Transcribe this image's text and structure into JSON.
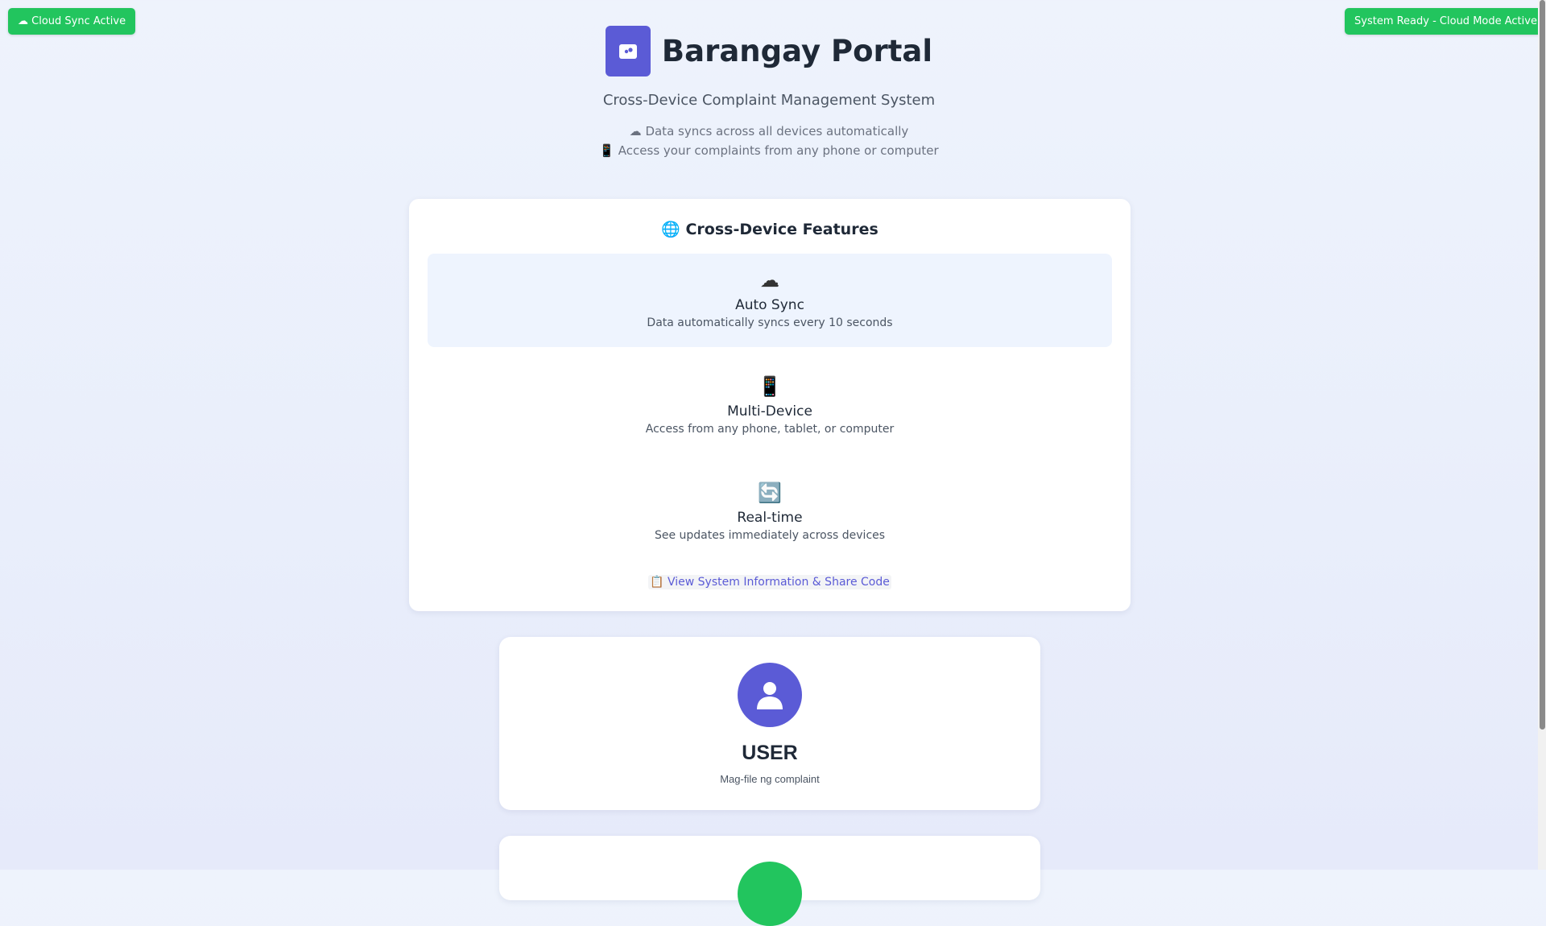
{
  "status": {
    "cloud_sync": "☁ Cloud Sync Active",
    "system_ready": "System Ready - Cloud Mode Active"
  },
  "header": {
    "title": "Barangay Portal",
    "subtitle": "Cross-Device Complaint Management System",
    "notes": [
      "☁ Data syncs across all devices automatically",
      "📱 Access your complaints from any phone or computer"
    ]
  },
  "features": {
    "title": "🌐 Cross-Device Features",
    "items": [
      {
        "icon": "☁",
        "title": "Auto Sync",
        "desc": "Data automatically syncs every 10 seconds"
      },
      {
        "icon": "📱",
        "title": "Multi-Device",
        "desc": "Access from any phone, tablet, or computer"
      },
      {
        "icon": "🔄",
        "title": "Real-time",
        "desc": "See updates immediately across devices"
      }
    ],
    "info_link": "📋 View System Information & Share Code"
  },
  "roles": [
    {
      "title": "USER",
      "desc": "Mag-file ng complaint"
    }
  ],
  "colors": {
    "accent": "#5b5bd6",
    "success": "#22c55e"
  }
}
